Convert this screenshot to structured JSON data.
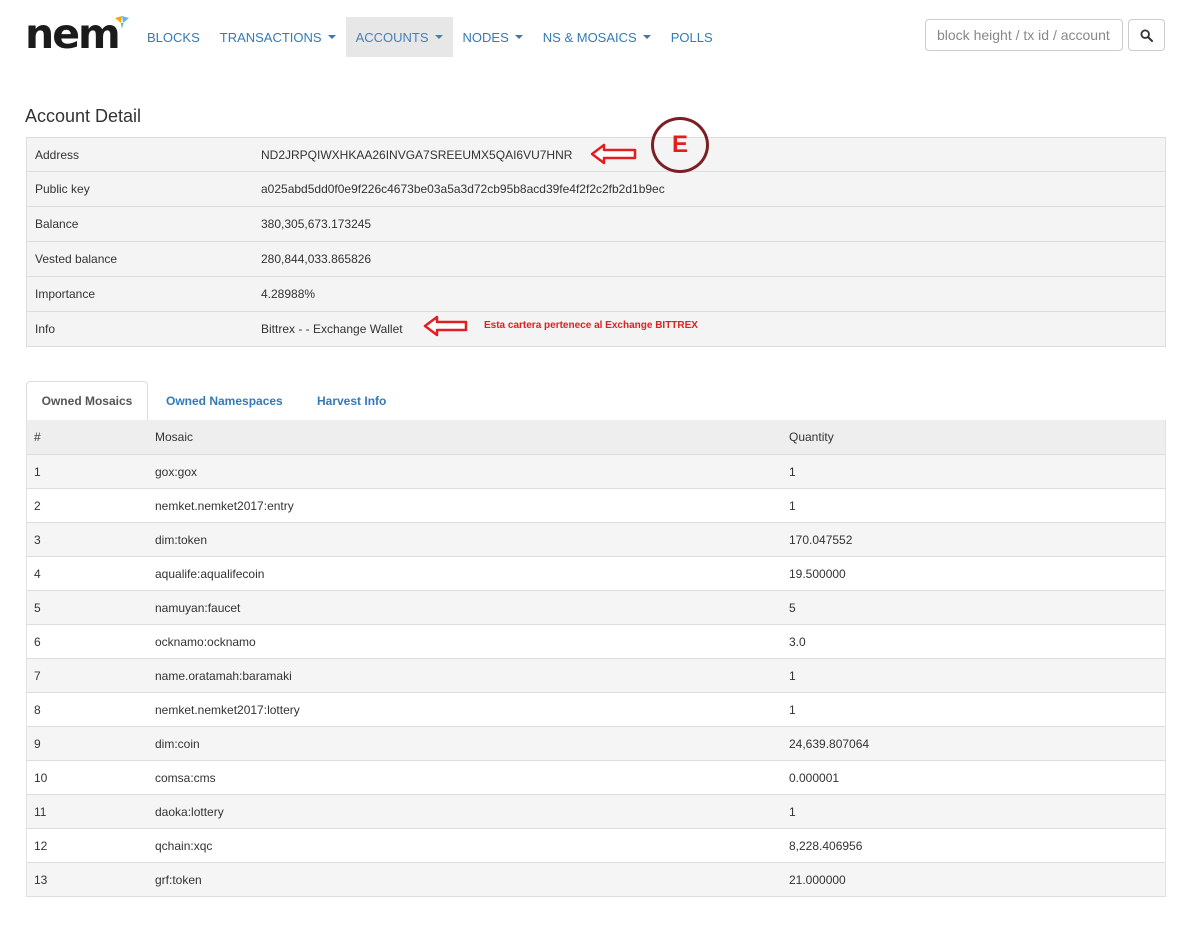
{
  "brand": {
    "logo_text": "nem"
  },
  "nav": {
    "items": [
      {
        "label": "BLOCKS",
        "dropdown": false,
        "active": false
      },
      {
        "label": "TRANSACTIONS",
        "dropdown": true,
        "active": false
      },
      {
        "label": "ACCOUNTS",
        "dropdown": true,
        "active": true
      },
      {
        "label": "NODES",
        "dropdown": true,
        "active": false
      },
      {
        "label": "NS & MOSAICS",
        "dropdown": true,
        "active": false
      },
      {
        "label": "POLLS",
        "dropdown": false,
        "active": false
      }
    ]
  },
  "search": {
    "placeholder": "block height / tx id / account",
    "button_icon": "search-icon"
  },
  "account": {
    "title": "Account Detail",
    "rows": [
      {
        "label": "Address",
        "value": "ND2JRPQIWXHKAA26INVGA7SREEUMX5QAI6VU7HNR"
      },
      {
        "label": "Public key",
        "value": "a025abd5dd0f0e9f226c4673be03a5a3d72cb95b8acd39fe4f2f2c2fb2d1b9ec"
      },
      {
        "label": "Balance",
        "value": "380,305,673.173245"
      },
      {
        "label": "Vested balance",
        "value": "280,844,033.865826"
      },
      {
        "label": "Importance",
        "value": "4.28988%"
      },
      {
        "label": "Info",
        "value": "Bittrex - - Exchange Wallet"
      }
    ]
  },
  "annotations": {
    "circle_label": "E",
    "note": "Esta cartera pertenece al Exchange BITTREX",
    "color": "#e02020",
    "circle_color": "#7a1f24"
  },
  "tabs": [
    {
      "label": "Owned Mosaics",
      "active": true
    },
    {
      "label": "Owned Namespaces",
      "active": false
    },
    {
      "label": "Harvest Info",
      "active": false
    }
  ],
  "mosaics": {
    "headers": [
      "#",
      "Mosaic",
      "Quantity"
    ],
    "rows": [
      [
        "1",
        "gox:gox",
        "1"
      ],
      [
        "2",
        "nemket.nemket2017:entry",
        "1"
      ],
      [
        "3",
        "dim:token",
        "170.047552"
      ],
      [
        "4",
        "aqualife:aqualifecoin",
        "19.500000"
      ],
      [
        "5",
        "namuyan:faucet",
        "5"
      ],
      [
        "6",
        "ocknamo:ocknamo",
        "3.0"
      ],
      [
        "7",
        "name.oratamah:baramaki",
        "1"
      ],
      [
        "8",
        "nemket.nemket2017:lottery",
        "1"
      ],
      [
        "9",
        "dim:coin",
        "24,639.807064"
      ],
      [
        "10",
        "comsa:cms",
        "0.000001"
      ],
      [
        "11",
        "daoka:lottery",
        "1"
      ],
      [
        "12",
        "qchain:xqc",
        "8,228.406956"
      ],
      [
        "13",
        "grf:token",
        "21.000000"
      ]
    ]
  },
  "colors": {
    "link": "#337ab7",
    "nav_active_bg": "#e7e7e7"
  }
}
